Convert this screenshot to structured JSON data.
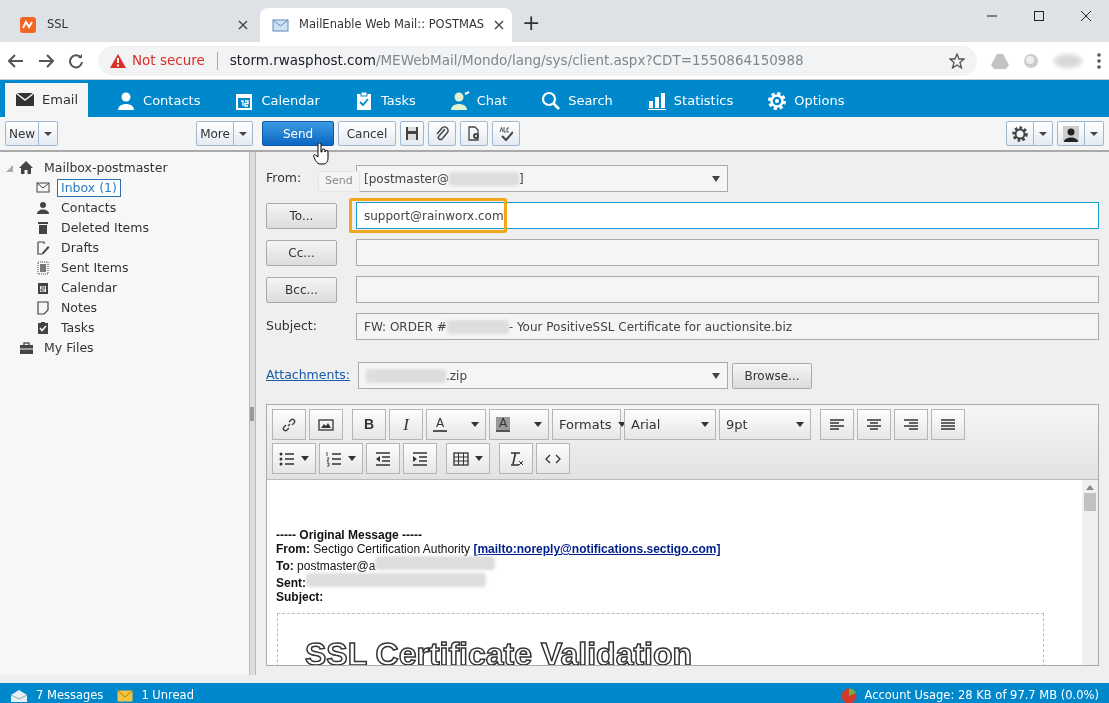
{
  "browser": {
    "tabs": [
      {
        "title": "SSL",
        "selected": false
      },
      {
        "title": "MailEnable Web Mail:: POSTMAS",
        "selected": true
      }
    ],
    "new_tab": "+",
    "address": {
      "warning": "Not secure",
      "host": "storm.rwasphost.com",
      "path": "/MEWebMail/Mondo/lang/sys/client.aspx?CDT=1550864150988"
    }
  },
  "nav": [
    {
      "label": "Email",
      "selected": true
    },
    {
      "label": "Contacts",
      "selected": false
    },
    {
      "label": "Calendar",
      "selected": false
    },
    {
      "label": "Tasks",
      "selected": false
    },
    {
      "label": "Chat",
      "selected": false
    },
    {
      "label": "Search",
      "selected": false
    },
    {
      "label": "Statistics",
      "selected": false
    },
    {
      "label": "Options",
      "selected": false
    }
  ],
  "toolbar": {
    "new": "New",
    "more": "More",
    "send": "Send",
    "cancel": "Cancel",
    "tooltip": "Send"
  },
  "sidebar": {
    "tree": [
      {
        "label": "Mailbox-postmaster",
        "expanded": true,
        "selected": false,
        "children": [
          {
            "label": "Inbox (1)",
            "selected": true
          },
          {
            "label": "Contacts",
            "selected": false
          },
          {
            "label": "Deleted Items",
            "selected": false
          },
          {
            "label": "Drafts",
            "selected": false
          },
          {
            "label": "Sent Items",
            "selected": false
          },
          {
            "label": "Calendar",
            "selected": false
          },
          {
            "label": "Notes",
            "selected": false
          },
          {
            "label": "Tasks",
            "selected": false
          }
        ]
      },
      {
        "label": "My Files",
        "selected": false
      }
    ]
  },
  "compose": {
    "from": {
      "label": "From:",
      "value_start": "[postmaster@",
      "value_end": "]"
    },
    "to": {
      "button": "To...",
      "value": "support@rainworx.com",
      "focused": true,
      "highlighted": true
    },
    "cc": {
      "button": "Cc..."
    },
    "bcc": {
      "button": "Bcc..."
    },
    "subject": {
      "label": "Subject:",
      "value_start": "FW: ORDER #",
      "value_end": " - Your PositiveSSL Certificate for auctionsite.biz"
    },
    "attachments": {
      "label": "Attachments:",
      "file_end": ".zip",
      "browse": "Browse..."
    }
  },
  "editor": {
    "bold": "B",
    "italic": "I",
    "text_color": "A",
    "bg_color": "A",
    "formats": "Formats",
    "font": "Arial",
    "size": "9pt",
    "lines": [
      {
        "text": "**----- Original Message -----**"
      },
      {
        "text": "**From:** Sectigo Certification Authority ",
        "link": "[mailto:noreply@notifications.sectigo.com]"
      },
      {
        "text": "**To:** postmaster@a",
        "redacted": true
      },
      {
        "text": "**Sent:**",
        "redacted": true
      },
      {
        "text": "**Subject:**"
      }
    ],
    "banner": "SSL Certificate Validation"
  },
  "status_bar": {
    "messages": "7 Messages",
    "unread": "1 Unread",
    "usage": "Account Usage: 28 KB of 97.7 MB (0.0%)"
  }
}
